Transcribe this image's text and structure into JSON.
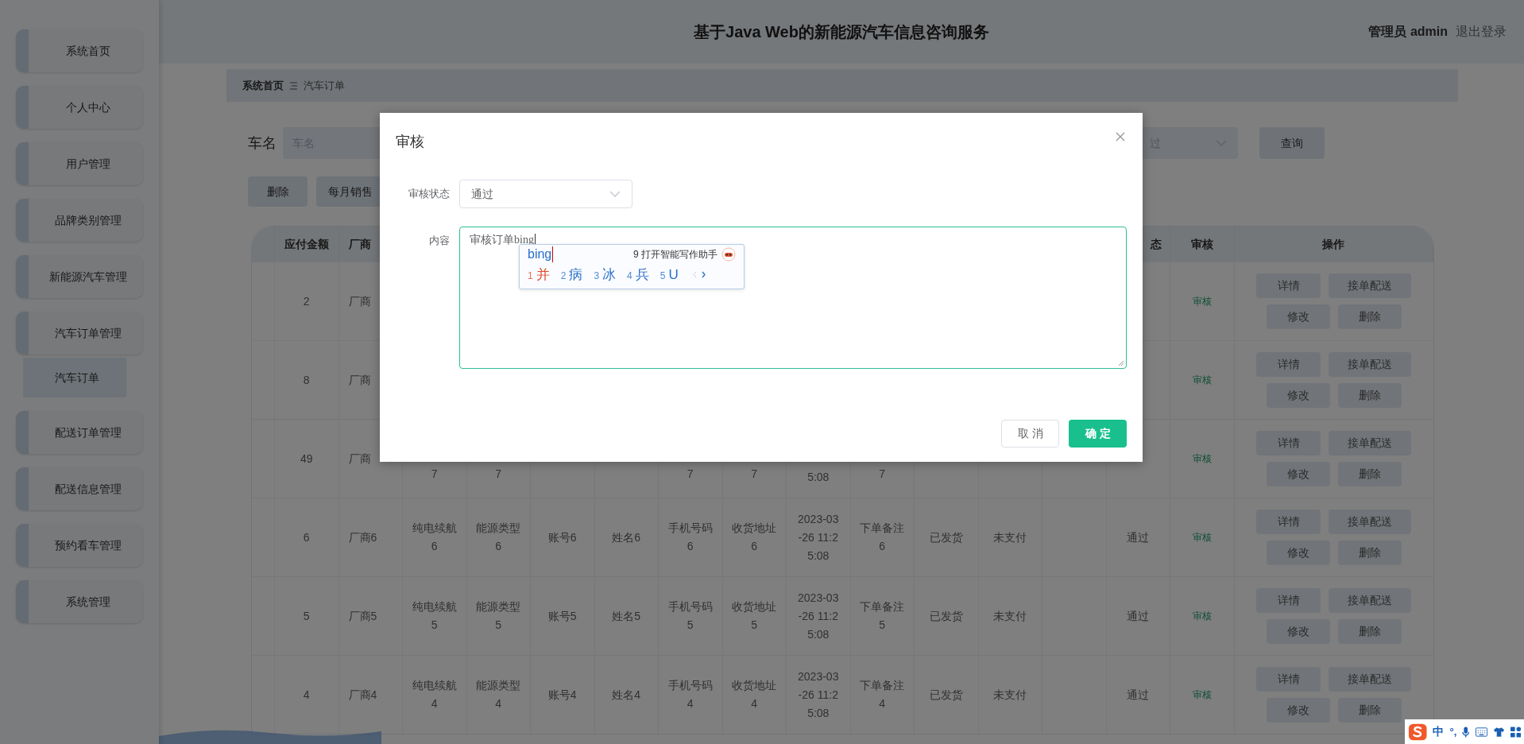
{
  "sidebar": {
    "items": [
      {
        "label": "系统首页",
        "selected": false
      },
      {
        "label": "个人中心",
        "selected": false
      },
      {
        "label": "用户管理",
        "selected": false
      },
      {
        "label": "品牌类别管理",
        "selected": false
      },
      {
        "label": "新能源汽车管理",
        "selected": false
      },
      {
        "label": "汽车订单管理",
        "selected": false,
        "children": [
          {
            "label": "汽车订单",
            "selected": true
          }
        ]
      },
      {
        "label": "配送订单管理",
        "selected": false
      },
      {
        "label": "配送信息管理",
        "selected": false
      },
      {
        "label": "预约看车管理",
        "selected": false
      },
      {
        "label": "系统管理",
        "selected": false
      }
    ]
  },
  "header": {
    "title": "基于Java Web的新能源汽车信息咨询服务",
    "user": "管理员 admin",
    "logout": "退出登录"
  },
  "breadcrumb": [
    "系统首页",
    "汽车订单"
  ],
  "search": {
    "label": "车名",
    "placeholder": "车名",
    "select_value": "过",
    "button": "查询"
  },
  "toolbar": [
    "删除",
    "每月销售"
  ],
  "table": {
    "columns": [
      null,
      "应付金额",
      "厂商",
      null,
      null,
      null,
      null,
      null,
      null,
      null,
      null,
      null,
      null,
      null,
      "态",
      "审核",
      "操作"
    ],
    "rows": [
      {
        "cells": [
          null,
          "2",
          "厂商",
          null,
          null,
          null,
          null,
          null,
          null,
          null,
          null,
          null,
          null,
          null,
          null,
          "审核"
        ],
        "actions": [
          "详情",
          "接单配送",
          "修改",
          "删除"
        ]
      },
      {
        "cells": [
          null,
          "8",
          "厂商",
          null,
          null,
          null,
          null,
          null,
          null,
          null,
          null,
          null,
          null,
          null,
          null,
          "审核"
        ],
        "actions": [
          "详情",
          "接单配送",
          "修改",
          "删除"
        ]
      },
      {
        "partial": true,
        "cells": [
          null,
          "49",
          "厂商",
          "7",
          "7",
          null,
          null,
          "7",
          "7",
          "5:08",
          "7",
          null,
          null,
          null,
          null,
          "审核"
        ],
        "actions": [
          "详情",
          "接单配送",
          "修改",
          "删除"
        ]
      },
      {
        "cells": [
          null,
          "6",
          "厂商6",
          "纯电续航6",
          "能源类型6",
          "账号6",
          "姓名6",
          "手机号码6",
          "收货地址6",
          "2023-03-26 11:25:08",
          "下单备注6",
          "已发货",
          "未支付",
          null,
          "通过",
          "审核"
        ],
        "actions": [
          "详情",
          "接单配送",
          "修改",
          "删除"
        ]
      },
      {
        "cells": [
          null,
          "5",
          "厂商5",
          "纯电续航5",
          "能源类型5",
          "账号5",
          "姓名5",
          "手机号码5",
          "收货地址5",
          "2023-03-26 11:25:08",
          "下单备注5",
          "已发货",
          "未支付",
          null,
          "通过",
          "审核"
        ],
        "actions": [
          "详情",
          "接单配送",
          "修改",
          "删除"
        ]
      },
      {
        "cells": [
          null,
          "4",
          "厂商4",
          "纯电续航4",
          "能源类型4",
          "账号4",
          "姓名4",
          "手机号码4",
          "收货地址4",
          "2023-03-26 11:25:08",
          "下单备注4",
          "已发货",
          "未支付",
          null,
          "通过",
          "审核"
        ],
        "actions": [
          "详情",
          "接单配送",
          "修改",
          "删除"
        ]
      }
    ]
  },
  "modal": {
    "title": "审核",
    "fields": [
      {
        "kind": "select",
        "label": "审核状态",
        "value": "通过"
      },
      {
        "kind": "textarea",
        "label": "内容",
        "value": "审核订单",
        "composing": "bing"
      }
    ],
    "buttons": [
      {
        "label": "取消",
        "primary": false
      },
      {
        "label": "确定",
        "primary": true
      }
    ]
  },
  "ime": {
    "pinyin": "bing",
    "assistant": "9 打开智能写作助手",
    "candidates": [
      {
        "index": "1",
        "text": "并",
        "selected": true
      },
      {
        "index": "2",
        "text": "病",
        "selected": false
      },
      {
        "index": "3",
        "text": "冰",
        "selected": false
      },
      {
        "index": "4",
        "text": "兵",
        "selected": false
      },
      {
        "index": "5",
        "text": "U",
        "selected": false
      }
    ]
  },
  "ime_toolbar": {
    "mode": "中",
    "punctuation": "°,"
  }
}
